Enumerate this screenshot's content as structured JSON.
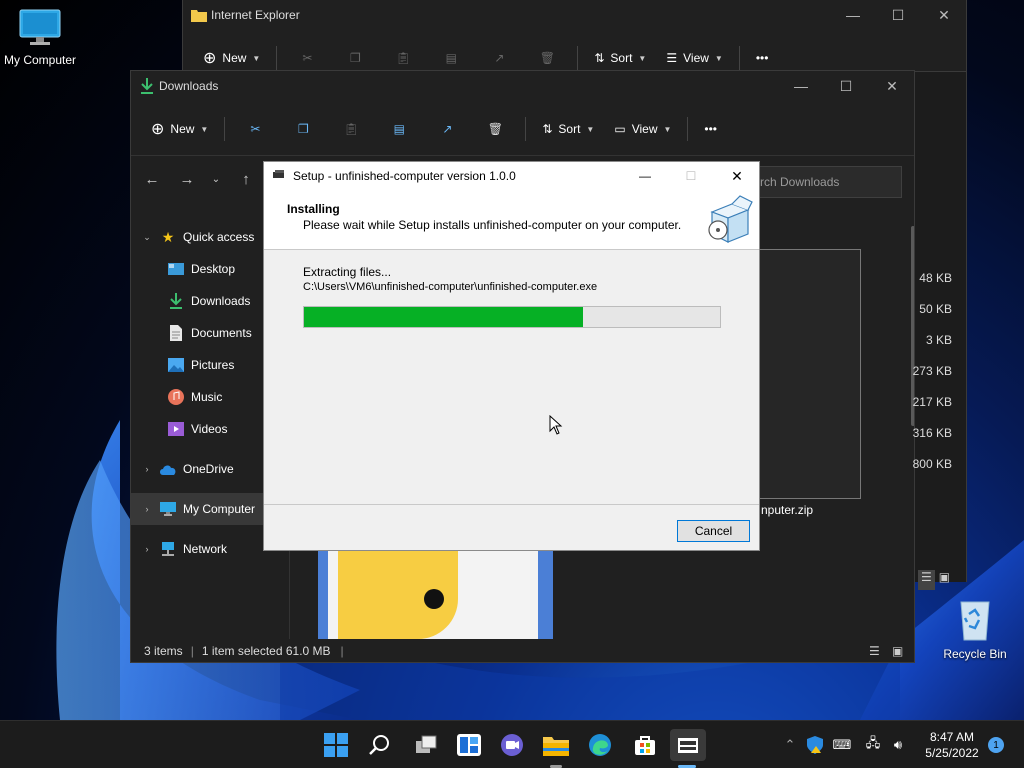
{
  "desktop": {
    "icons": [
      {
        "label": "My Computer",
        "icon": "monitor-icon"
      },
      {
        "label": "Recycle Bin",
        "icon": "recycle-bin-icon"
      }
    ]
  },
  "ie_window": {
    "title": "Internet Explorer",
    "toolbar": {
      "new_label": "New",
      "sort_label": "Sort",
      "view_label": "View",
      "more": "•••"
    }
  },
  "downloads_window": {
    "title": "Downloads",
    "toolbar": {
      "new_label": "New",
      "sort_label": "Sort",
      "view_label": "View",
      "more": "•••"
    },
    "search_placeholder": "rch Downloads",
    "nav": [
      {
        "label": "Quick access",
        "icon": "star-icon",
        "expanded": true
      },
      {
        "label": "Desktop",
        "icon": "desktop-icon"
      },
      {
        "label": "Downloads",
        "icon": "download-icon"
      },
      {
        "label": "Documents",
        "icon": "document-icon"
      },
      {
        "label": "Pictures",
        "icon": "pictures-icon"
      },
      {
        "label": "Music",
        "icon": "music-icon"
      },
      {
        "label": "Videos",
        "icon": "videos-icon"
      },
      {
        "label": "OneDrive",
        "icon": "cloud-icon"
      },
      {
        "label": "My Computer",
        "icon": "monitor-icon",
        "selected": true
      },
      {
        "label": "Network",
        "icon": "network-icon"
      }
    ],
    "sizes": [
      "48 KB",
      "50 KB",
      "3 KB",
      "273 KB",
      "217 KB",
      "316 KB",
      "800 KB"
    ],
    "file_name_partial": "nputer.zip",
    "status": {
      "items": "3 items",
      "selected": "1 item selected  61.0 MB"
    }
  },
  "setup": {
    "title": "Setup - unfinished-computer version 1.0.0",
    "heading": "Installing",
    "subheading": "Please wait while Setup installs unfinished-computer on your computer.",
    "status_line": "Extracting files...",
    "path": "C:\\Users\\VM6\\unfinished-computer\\unfinished-computer.exe",
    "progress_fraction": 0.67,
    "cancel_label": "Cancel"
  },
  "taskbar": {
    "time": "8:47 AM",
    "date": "5/25/2022",
    "notification_count": "1"
  },
  "colors": {
    "progress": "#06b025",
    "accent": "#0078d7"
  }
}
